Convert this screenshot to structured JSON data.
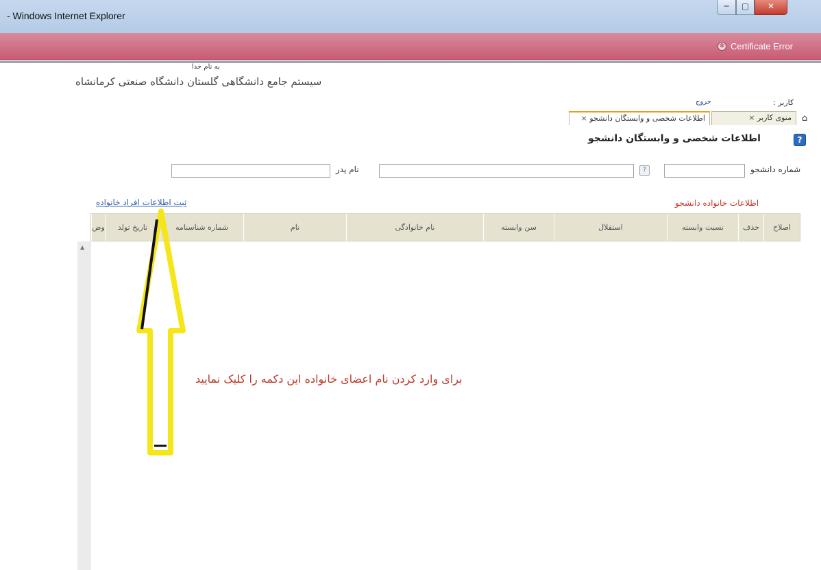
{
  "window": {
    "title": "- Windows Internet Explorer",
    "min": "─",
    "max": "▢",
    "close": "✕"
  },
  "cert": {
    "icon": "⊗",
    "text": "Certificate Error"
  },
  "header": {
    "bismillah": "به نام خدا",
    "system_title": "سیستم جامع دانشگاهی گلستان   دانشگاه صنعتی کرمانشاه",
    "user_label": "کاربر :",
    "logout": "خروج"
  },
  "tabs": [
    {
      "label": "منوی کاربر",
      "close": "×"
    },
    {
      "label": "اطلاعات شخصی و وابستگان دانشجو",
      "close": "×"
    }
  ],
  "home_icon": "⌂",
  "page": {
    "help": "?",
    "heading": "اطلاعات شخصی و وابستگان دانشجو"
  },
  "form": {
    "student_label": "شماره دانشجو",
    "father_label": "نام پدر",
    "help_btn": "?"
  },
  "section": {
    "family_label": "اطلاعات خانواده دانشجو",
    "register_link": "ثبت اطلاعات افراد خانواده"
  },
  "table": {
    "columns": [
      "اصلاح",
      "حذف",
      "نسبت وابسته",
      "استقلال",
      "سن وابسته",
      "نام خانوادگی",
      "نام",
      "شماره شناسنامه",
      "تاریخ تولد",
      "وض"
    ],
    "rows": []
  },
  "annotation": {
    "text": "برای وارد کردن نام اعضای خانواده این دکمه را کلیک نمایید",
    "arrow_color": "#f5e61a"
  },
  "colors": {
    "cert_bar": "#c85b74",
    "accent_red": "#c0392b",
    "link_blue": "#2a5db0",
    "table_header": "#e6e2d0"
  }
}
